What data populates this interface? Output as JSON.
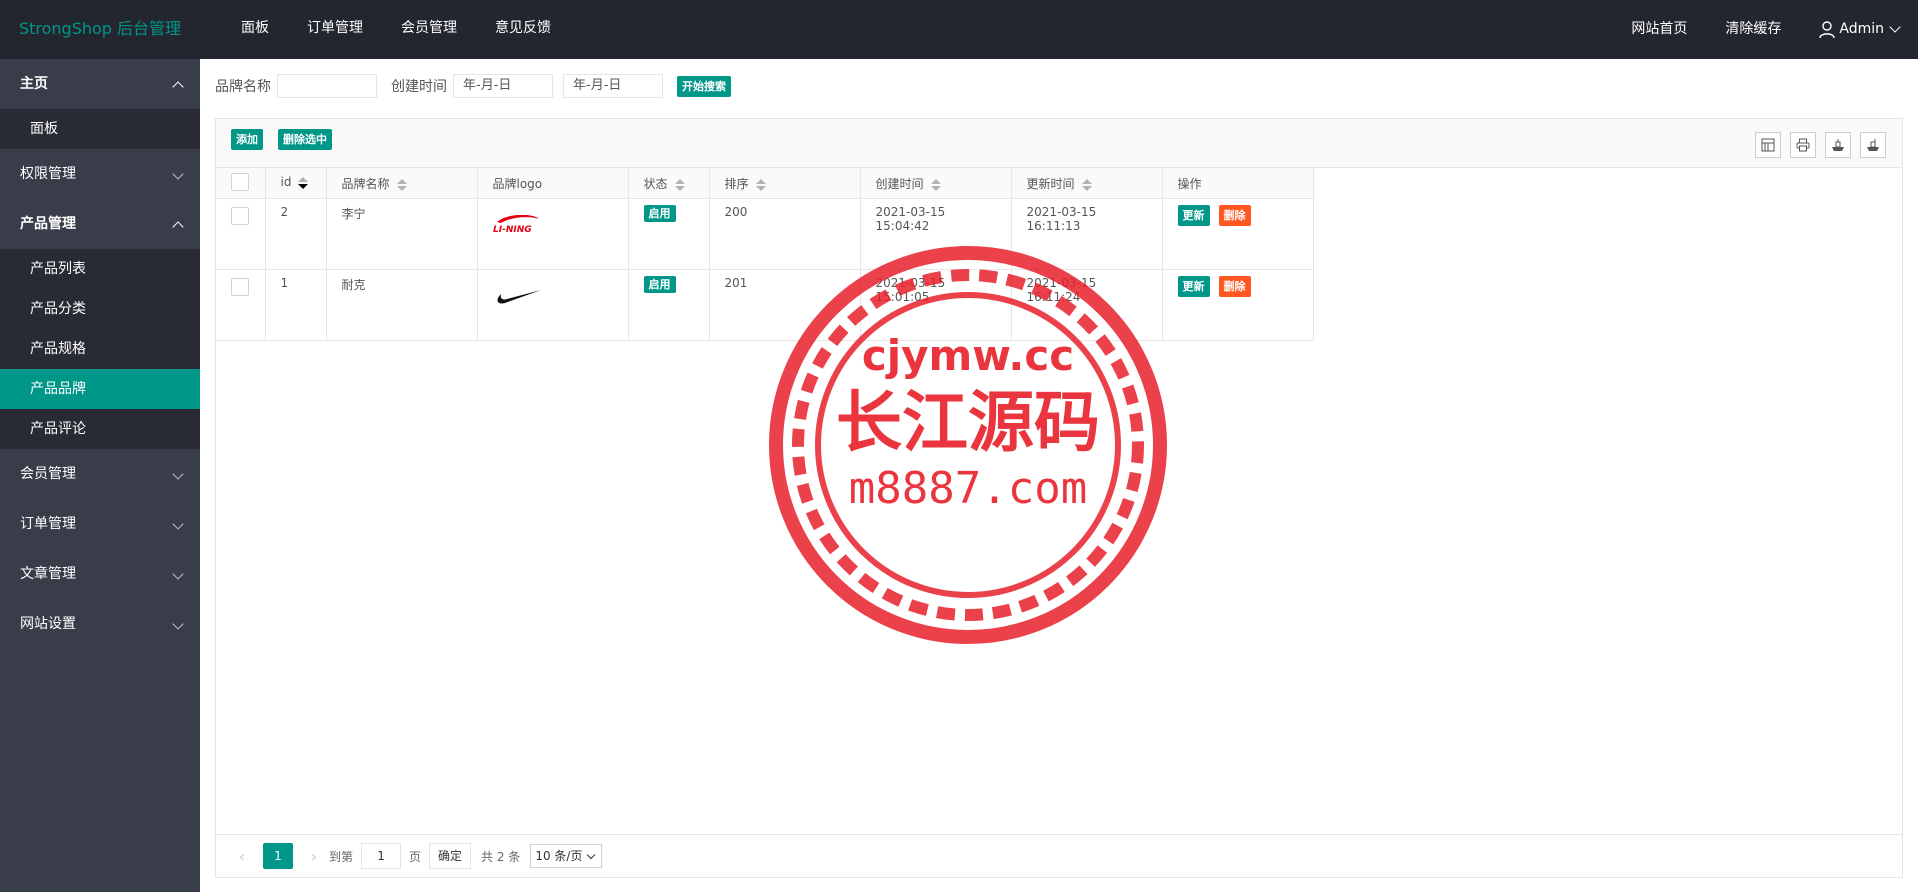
{
  "header": {
    "logo": "StrongShop 后台管理",
    "nav": [
      "面板",
      "订单管理",
      "会员管理",
      "意见反馈"
    ],
    "right_nav": [
      "网站首页",
      "清除缓存"
    ],
    "user": "Admin"
  },
  "sidebar": {
    "groups": [
      {
        "label": "主页",
        "open": true,
        "items": [
          "面板"
        ]
      },
      {
        "label": "权限管理",
        "open": false
      },
      {
        "label": "产品管理",
        "open": true,
        "items": [
          "产品列表",
          "产品分类",
          "产品规格",
          "产品品牌",
          "产品评论"
        ],
        "active": "产品品牌"
      },
      {
        "label": "会员管理",
        "open": false
      },
      {
        "label": "订单管理",
        "open": false
      },
      {
        "label": "文章管理",
        "open": false
      },
      {
        "label": "网站设置",
        "open": false
      }
    ]
  },
  "search": {
    "brand_label": "品牌名称",
    "created_label": "创建时间",
    "date_from": "年-月-日",
    "date_to": "年-月-日",
    "search_button": "开始搜索"
  },
  "toolbar": {
    "add": "添加",
    "delete_selected": "删除选中"
  },
  "table": {
    "columns": [
      "id",
      "品牌名称",
      "品牌logo",
      "状态",
      "排序",
      "创建时间",
      "更新时间",
      "操作"
    ],
    "rows": [
      {
        "id": "2",
        "name": "李宁",
        "logo": "li-ning-logo",
        "status": "启用",
        "sort": "200",
        "created": "2021-03-15 15:04:42",
        "updated": "2021-03-15 16:11:13"
      },
      {
        "id": "1",
        "name": "耐克",
        "logo": "nike-swoosh-logo",
        "status": "启用",
        "sort": "201",
        "created": "2021-03-15 15:01:05",
        "updated": "2021-03-15 16:11:24"
      }
    ],
    "update_label": "更新",
    "delete_label": "删除"
  },
  "pager": {
    "current": "1",
    "goto_label": "到第",
    "page_value": "1",
    "page_unit": "页",
    "confirm": "确定",
    "total": "共 2 条",
    "page_size": "10 条/页"
  },
  "watermark": {
    "line1": "cjymw.cc",
    "line2": "长江源码",
    "line3": "m8887.com"
  },
  "colors": {
    "primary": "#009688",
    "danger": "#ff5722",
    "header": "#23262e",
    "sidebar": "#393d49"
  }
}
